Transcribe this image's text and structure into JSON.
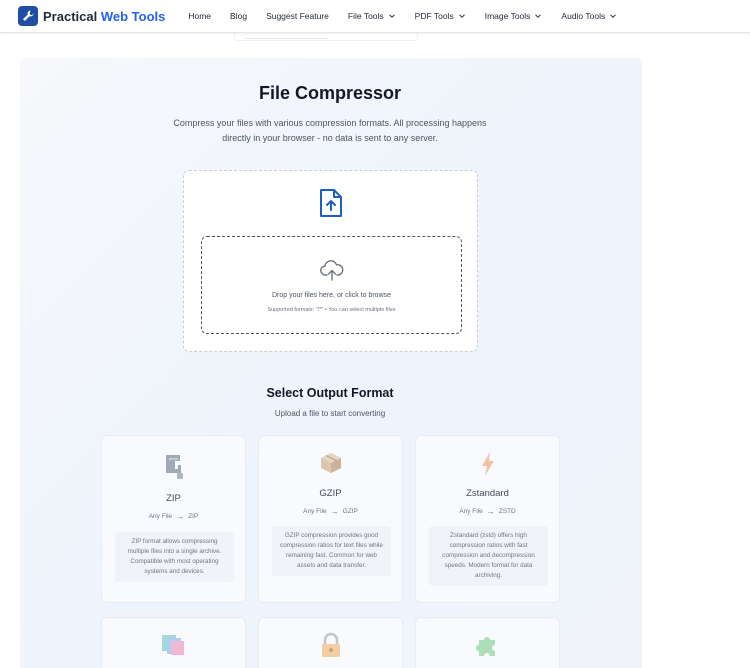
{
  "header": {
    "logo_text_1": "Practical ",
    "logo_text_2": "Web Tools",
    "nav": [
      {
        "label": "Home"
      },
      {
        "label": "Blog"
      },
      {
        "label": "Suggest Feature"
      },
      {
        "label": "File Tools"
      },
      {
        "label": "PDF Tools"
      },
      {
        "label": "Image Tools"
      },
      {
        "label": "Audio Tools"
      }
    ]
  },
  "main": {
    "title": "File Compressor",
    "subtitle": "Compress your files with various compression formats. All processing happens directly in your browser - no data is sent to any server.",
    "upload": {
      "drop_text": "Drop your files here, or click to browse",
      "supported_text": "Supported formats: \"/*\" • You can select multiple files"
    },
    "format_section": {
      "title": "Select Output Format",
      "subtitle": "Upload a file to start converting"
    },
    "formats": [
      {
        "name": "ZIP",
        "from": "Any File",
        "arrow": "→",
        "to": "ZIP",
        "description": "ZIP format allows compressing multiple files into a single archive. Compatible with most operating systems and devices."
      },
      {
        "name": "GZIP",
        "from": "Any File",
        "arrow": "→",
        "to": "GZIP",
        "description": "GZIP compression provides good compression ratios for text files while remaining fast. Common for web assets and data transfer."
      },
      {
        "name": "Zstandard",
        "from": "Any File",
        "arrow": "→",
        "to": "ZSTD",
        "description": "Zstandard (zstd) offers high compression ratios with fast compression and decompression speeds. Modern format for data archiving."
      }
    ]
  },
  "colors": {
    "accent": "#2563eb",
    "logo_bg": "#1e4fa3",
    "panel_bg": "#eef4fd"
  },
  "icons": [
    "wrench-logo-icon",
    "chevron-down-icon",
    "file-upload-icon",
    "cloud-upload-icon",
    "zip-clamp-icon",
    "box-icon",
    "lightning-icon",
    "stack-icon",
    "lock-icon",
    "puzzle-icon"
  ]
}
